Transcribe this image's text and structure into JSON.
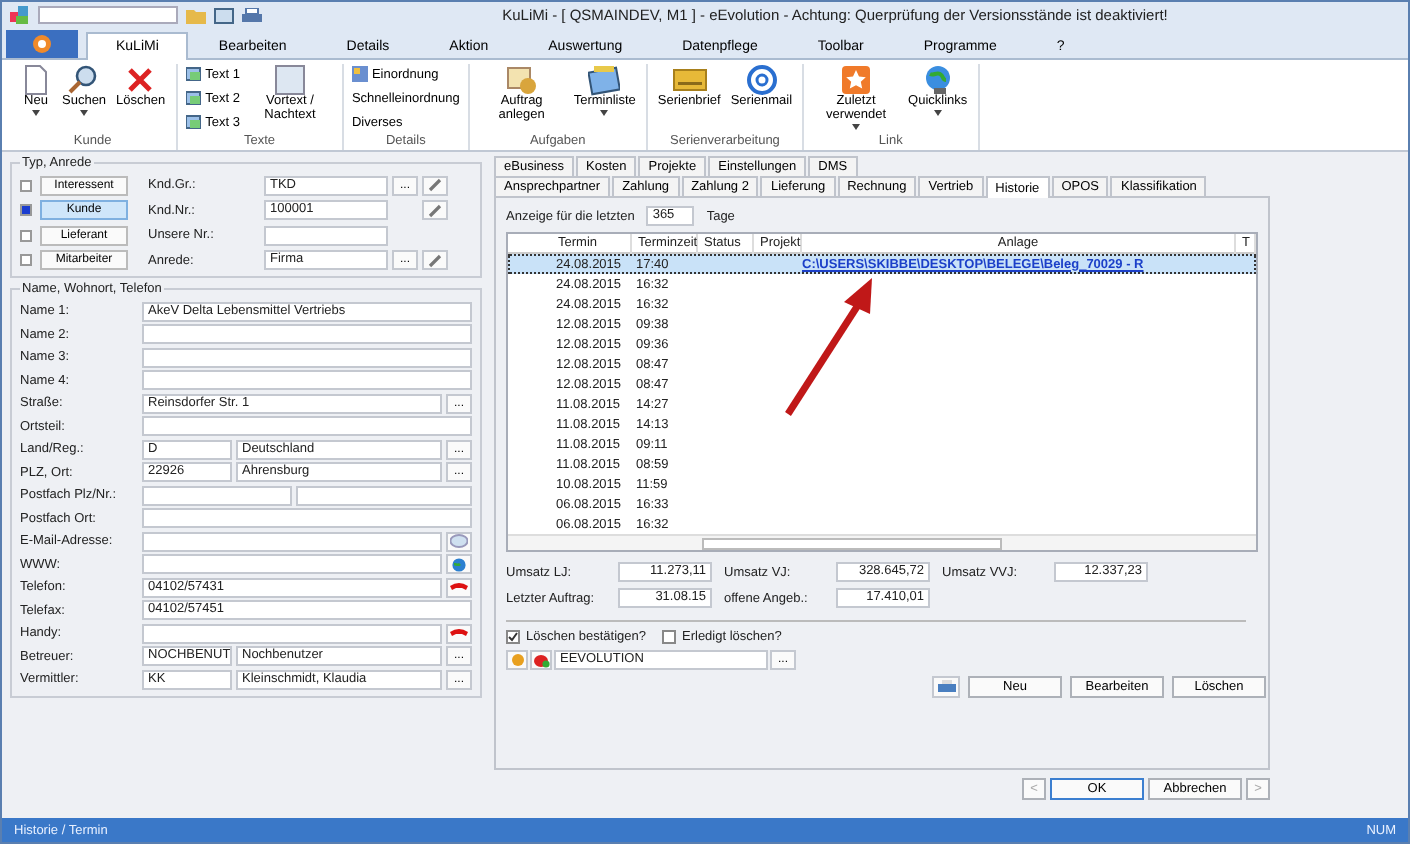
{
  "window": {
    "title": "KuLiMi - [ QSMAINDEV, M1 ]  -  eEvolution - Achtung: Querprüfung der Versionsstände ist deaktiviert!"
  },
  "ribbon": {
    "tabs": [
      {
        "label": "KuLiMi",
        "selected": true
      },
      {
        "label": "Bearbeiten",
        "selected": false
      },
      {
        "label": "Details",
        "selected": false
      },
      {
        "label": "Aktion",
        "selected": false
      },
      {
        "label": "Auswertung",
        "selected": false
      },
      {
        "label": "Datenpflege",
        "selected": false
      },
      {
        "label": "Toolbar",
        "selected": false
      },
      {
        "label": "Programme",
        "selected": false
      },
      {
        "label": "?",
        "selected": false
      }
    ],
    "groups": [
      {
        "label": "Kunde",
        "items": [
          {
            "kind": "large",
            "label": "Neu",
            "dropdown": true
          },
          {
            "kind": "large",
            "label": "Suchen",
            "dropdown": true
          },
          {
            "kind": "large",
            "label": "Löschen",
            "dropdown": false
          }
        ]
      },
      {
        "label": "Texte",
        "items": [
          {
            "kind": "small",
            "label": "Text 1"
          },
          {
            "kind": "small",
            "label": "Text 2"
          },
          {
            "kind": "small",
            "label": "Text 3"
          },
          {
            "kind": "large",
            "label": "Vortext / Nachtext",
            "dropdown": false
          }
        ]
      },
      {
        "label": "Details",
        "items": [
          {
            "kind": "small",
            "label": "Einordnung"
          },
          {
            "kind": "text",
            "label": "Schnelleinordnung"
          },
          {
            "kind": "text",
            "label": "Diverses"
          }
        ]
      },
      {
        "label": "Aufgaben",
        "items": [
          {
            "kind": "large",
            "label": "Auftrag anlegen",
            "dropdown": false
          },
          {
            "kind": "large",
            "label": "Terminliste",
            "dropdown": true
          }
        ]
      },
      {
        "label": "Serienverarbeitung",
        "items": [
          {
            "kind": "large",
            "label": "Serienbrief",
            "dropdown": false
          },
          {
            "kind": "large",
            "label": "Serienmail",
            "dropdown": false
          }
        ]
      },
      {
        "label": "Link",
        "items": [
          {
            "kind": "large",
            "label": "Zuletzt verwendet",
            "dropdown": true
          },
          {
            "kind": "large",
            "label": "Quicklinks",
            "dropdown": true
          }
        ]
      }
    ]
  },
  "type_group": {
    "title": "Typ, Anrede",
    "options": [
      {
        "label": "Interessent",
        "checked": false,
        "selected": false
      },
      {
        "label": "Kunde",
        "checked": true,
        "selected": true
      },
      {
        "label": "Lieferant",
        "checked": false,
        "selected": false
      },
      {
        "label": "Mitarbeiter",
        "checked": false,
        "selected": false
      }
    ],
    "fields": [
      {
        "label": "Knd.Gr.:",
        "value": "TKD",
        "button_label": "...",
        "editable": true
      },
      {
        "label": "Knd.Nr.:",
        "value": "100001",
        "editable": true
      },
      {
        "label": "Unsere Nr.:",
        "editable": false
      },
      {
        "label": "Anrede:",
        "value": "Firma",
        "button_label": "...",
        "editable": true
      }
    ]
  },
  "address_group": {
    "title": "Name, Wohnort, Telefon",
    "rows": [
      {
        "label": "Name 1:",
        "kind": "single",
        "values": [
          "AkeV Delta Lebensmittel Vertriebs"
        ]
      },
      {
        "label": "Name 2:",
        "kind": "single"
      },
      {
        "label": "Name 3:",
        "kind": "single"
      },
      {
        "label": "Name 4:",
        "kind": "single"
      },
      {
        "label": "Straße:",
        "kind": "single",
        "values": [
          "Reinsdorfer Str. 1"
        ],
        "button_label": "..."
      },
      {
        "label": "Ortsteil:",
        "kind": "single"
      },
      {
        "label": "Land/Reg.:",
        "kind": "code",
        "values": [
          "D",
          "Deutschland"
        ],
        "button_label": "..."
      },
      {
        "label": "PLZ, Ort:",
        "kind": "code",
        "values": [
          "22926",
          "Ahrensburg"
        ],
        "button_label": "..."
      },
      {
        "label": "Postfach Plz/Nr.:",
        "kind": "pair"
      },
      {
        "label": "Postfach Ort:",
        "kind": "single"
      },
      {
        "label": "E-Mail-Adresse:",
        "kind": "single",
        "button": {
          "kind": "mail"
        }
      },
      {
        "label": "WWW:",
        "kind": "single",
        "button": {
          "kind": "web"
        }
      },
      {
        "label": "Telefon:",
        "kind": "single",
        "values": [
          "04102/57431"
        ],
        "button": {
          "kind": "phone"
        }
      },
      {
        "label": "Telefax:",
        "kind": "single",
        "values": [
          "04102/57451"
        ]
      },
      {
        "label": "Handy:",
        "kind": "single",
        "button": {
          "kind": "phone"
        }
      },
      {
        "label": "Betreuer:",
        "kind": "code",
        "values": [
          "NOCHBENUT",
          "Nochbenutzer"
        ],
        "button_label": "..."
      },
      {
        "label": "Vermittler:",
        "kind": "code",
        "values": [
          "KK",
          "Kleinschmidt, Klaudia"
        ],
        "button_label": "..."
      }
    ]
  },
  "detail_tabs": {
    "row_1": [
      {
        "label": "eBusiness",
        "selected": false
      },
      {
        "label": "Kosten",
        "selected": false
      },
      {
        "label": "Projekte",
        "selected": false
      },
      {
        "label": "Einstellungen",
        "selected": false
      },
      {
        "label": "DMS",
        "selected": false
      }
    ],
    "row_2": [
      {
        "label": "Ansprechpartner",
        "selected": false
      },
      {
        "label": "Zahlung",
        "selected": false
      },
      {
        "label": "Zahlung 2",
        "selected": false
      },
      {
        "label": "Lieferung",
        "selected": false
      },
      {
        "label": "Rechnung",
        "selected": false
      },
      {
        "label": "Vertrieb",
        "selected": false
      },
      {
        "label": "Historie",
        "selected": true
      },
      {
        "label": "OPOS",
        "selected": false
      },
      {
        "label": "Klassifikation",
        "selected": false
      }
    ]
  },
  "filter": {
    "label": "Anzeige für die letzten",
    "value": "365",
    "unit": "Tage"
  },
  "table": {
    "columns": [
      "Termin",
      "Terminzeit",
      "Status",
      "Projekt",
      "Anlage",
      "T"
    ],
    "rows": [
      {
        "termin": "24.08.2015",
        "zeit": "17:40",
        "anlage": "C:\\USERS\\SKIBBE\\DESKTOP\\BELEGE\\Beleg_70029 - R",
        "selected": true
      },
      {
        "termin": "24.08.2015",
        "zeit": "16:32",
        "selected": false
      },
      {
        "termin": "24.08.2015",
        "zeit": "16:32",
        "selected": false
      },
      {
        "termin": "12.08.2015",
        "zeit": "09:38",
        "selected": false
      },
      {
        "termin": "12.08.2015",
        "zeit": "09:36",
        "selected": false
      },
      {
        "termin": "12.08.2015",
        "zeit": "08:47",
        "selected": false
      },
      {
        "termin": "12.08.2015",
        "zeit": "08:47",
        "selected": false
      },
      {
        "termin": "11.08.2015",
        "zeit": "14:27",
        "selected": false
      },
      {
        "termin": "11.08.2015",
        "zeit": "14:13",
        "selected": false
      },
      {
        "termin": "11.08.2015",
        "zeit": "09:11",
        "selected": false
      },
      {
        "termin": "11.08.2015",
        "zeit": "08:59",
        "selected": false
      },
      {
        "termin": "10.08.2015",
        "zeit": "11:59",
        "selected": false
      },
      {
        "termin": "06.08.2015",
        "zeit": "16:33",
        "selected": false
      },
      {
        "termin": "06.08.2015",
        "zeit": "16:32",
        "selected": false
      }
    ]
  },
  "totals": [
    [
      {
        "label": "Umsatz LJ:",
        "value": "11.273,11"
      },
      {
        "label": "Umsatz VJ:",
        "value": "328.645,72"
      },
      {
        "label": "Umsatz VVJ:",
        "value": "12.337,23"
      }
    ],
    [
      {
        "label": "Letzter Auftrag:",
        "value": "31.08.15"
      },
      {
        "label": "offene Angeb.:",
        "value": "17.410,01"
      }
    ]
  ],
  "options": [
    {
      "label": "Löschen bestätigen?",
      "checked": true
    },
    {
      "label": "Erledigt löschen?",
      "checked": false
    }
  ],
  "user": {
    "value": "EEVOLUTION",
    "button_label": "..."
  },
  "actions": [
    "Neu",
    "Bearbeiten",
    "Löschen"
  ],
  "dialog_buttons": [
    {
      "label": "<",
      "disabled": true,
      "default": false
    },
    {
      "label": "OK",
      "disabled": false,
      "default": true
    },
    {
      "label": "Abbrechen",
      "disabled": false,
      "default": false
    },
    {
      "label": ">",
      "disabled": true,
      "default": false
    }
  ],
  "status_bar": {
    "left": "Historie / Termin",
    "right": "NUM"
  }
}
